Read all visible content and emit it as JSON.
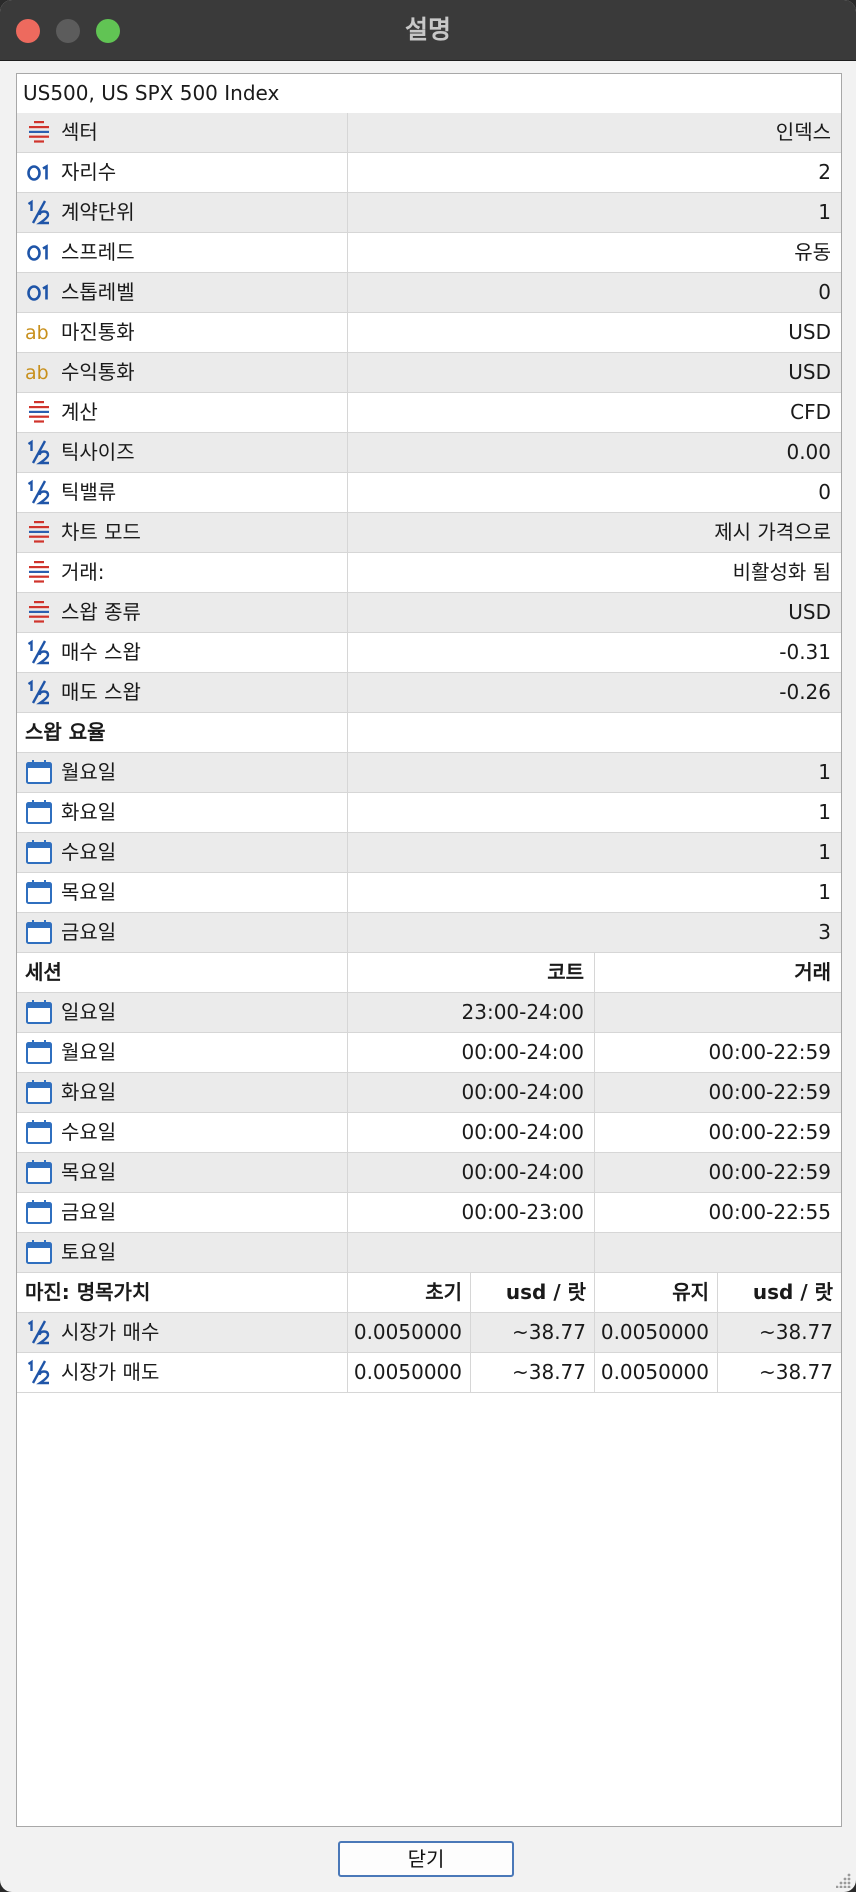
{
  "window": {
    "title": "설명",
    "close_button": "닫기"
  },
  "symbol_title": "US500, US SPX 500 Index",
  "properties": [
    {
      "icon": "list-icon",
      "label": "섹터",
      "value": "인덱스"
    },
    {
      "icon": "integer-icon",
      "label": "자리수",
      "value": "2"
    },
    {
      "icon": "fraction-icon",
      "label": "계약단위",
      "value": "1"
    },
    {
      "icon": "integer-icon",
      "label": "스프레드",
      "value": "유동"
    },
    {
      "icon": "integer-icon",
      "label": "스톱레벨",
      "value": "0"
    },
    {
      "icon": "text-icon",
      "label": "마진통화",
      "value": "USD"
    },
    {
      "icon": "text-icon",
      "label": "수익통화",
      "value": "USD"
    },
    {
      "icon": "list-icon",
      "label": "계산",
      "value": "CFD"
    },
    {
      "icon": "fraction-icon",
      "label": "틱사이즈",
      "value": "0.00"
    },
    {
      "icon": "fraction-icon",
      "label": "틱밸류",
      "value": "0"
    },
    {
      "icon": "list-icon",
      "label": "차트 모드",
      "value": "제시 가격으로"
    },
    {
      "icon": "list-icon",
      "label": "거래:",
      "value": "비활성화 됨"
    },
    {
      "icon": "list-icon",
      "label": "스왑 종류",
      "value": "USD"
    },
    {
      "icon": "fraction-icon",
      "label": "매수 스왑",
      "value": "-0.31"
    },
    {
      "icon": "fraction-icon",
      "label": "매도 스왑",
      "value": "-0.26"
    }
  ],
  "swap_rates": {
    "header": "스왑 요율",
    "rows": [
      {
        "label": "월요일",
        "value": "1"
      },
      {
        "label": "화요일",
        "value": "1"
      },
      {
        "label": "수요일",
        "value": "1"
      },
      {
        "label": "목요일",
        "value": "1"
      },
      {
        "label": "금요일",
        "value": "3"
      }
    ]
  },
  "sessions": {
    "header": "세션",
    "col_quote": "코트",
    "col_trade": "거래",
    "rows": [
      {
        "label": "일요일",
        "quote": "23:00-24:00",
        "trade": ""
      },
      {
        "label": "월요일",
        "quote": "00:00-24:00",
        "trade": "00:00-22:59"
      },
      {
        "label": "화요일",
        "quote": "00:00-24:00",
        "trade": "00:00-22:59"
      },
      {
        "label": "수요일",
        "quote": "00:00-24:00",
        "trade": "00:00-22:59"
      },
      {
        "label": "목요일",
        "quote": "00:00-24:00",
        "trade": "00:00-22:59"
      },
      {
        "label": "금요일",
        "quote": "00:00-23:00",
        "trade": "00:00-22:55"
      },
      {
        "label": "토요일",
        "quote": "",
        "trade": ""
      }
    ]
  },
  "margin": {
    "header": "마진: 명목가치",
    "col_initial": "초기",
    "col_initial_unit": "usd / 랏",
    "col_maint": "유지",
    "col_maint_unit": "usd / 랏",
    "rows": [
      {
        "label": "시장가 매수",
        "initial": "0.0050000",
        "initial_usd": "~38.77",
        "maint": "0.0050000",
        "maint_usd": "~38.77"
      },
      {
        "label": "시장가 매도",
        "initial": "0.0050000",
        "initial_usd": "~38.77",
        "maint": "0.0050000",
        "maint_usd": "~38.77"
      }
    ]
  },
  "colors": {
    "list_icon_red": "#d0342c",
    "list_icon_blue": "#2a5fb0",
    "number_icon": "#1f55a8",
    "text_icon": "#c8901c",
    "calendar_icon": "#2f6fbf"
  }
}
